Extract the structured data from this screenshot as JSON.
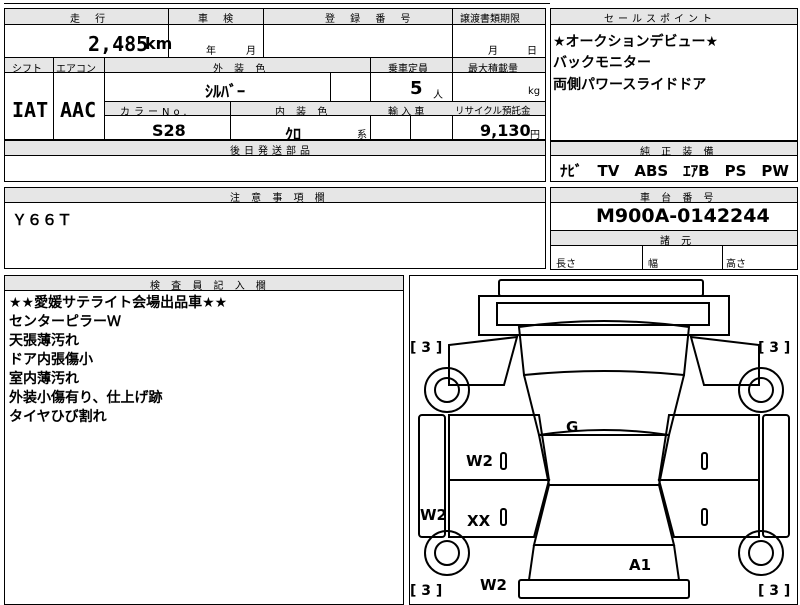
{
  "labels": {
    "mileage": "走 行",
    "inspection": "車 検",
    "registration": "登 録 番 号",
    "transfer_deadline": "譲渡書類期限",
    "sales_point": "セールスポイント",
    "shift": "シフト",
    "aircon": "エアコン",
    "exterior_color": "外 装 色",
    "capacity": "乗車定員",
    "max_load": "最大積載量",
    "color_no": "カラーNo.",
    "interior_color": "内 装 色",
    "import": "輸 入 車",
    "recycle_fee": "リサイクル預託金",
    "later_parts": "後日発送部品",
    "genuine_equipment": "純 正 装 備",
    "caution": "注 意 事 項 欄",
    "chassis_no": "車 台 番 号",
    "dimensions": "諸 元",
    "inspector_notes": "検 査 員 記 入 欄",
    "length": "長さ",
    "width": "幅",
    "height": "高さ"
  },
  "values": {
    "mileage": "2,485",
    "mileage_unit": "km",
    "inspection_year": "年",
    "inspection_month": "月",
    "transfer_month": "月",
    "transfer_day": "日",
    "shift": "IAT",
    "aircon": "AAC",
    "exterior_color": "ｼﾙﾊﾞｰ",
    "capacity": "5",
    "capacity_unit": "人",
    "max_load_unit": "kg",
    "color_no": "S28",
    "interior_color": "ｸﾛ",
    "interior_suffix": "系",
    "recycle_fee": "9,130",
    "recycle_unit": "円",
    "caution": "Ｙ６６Ｔ",
    "chassis_no": "M900A-0142244",
    "equipment": "ﾅﾋﾞ　TV　ABS　ｴｱB　PS　PW"
  },
  "sales_points": [
    "★オークションデビュー★",
    "バックモニター",
    "両側パワースライドドア"
  ],
  "inspector_notes": [
    "★★愛媛サテライト会場出品車★★",
    "センターピラーＷ",
    "天張薄汚れ",
    "ドア内張傷小",
    "室内薄汚れ",
    "外装小傷有り、仕上げ跡",
    "タイヤひび割れ"
  ],
  "damage_marks": {
    "G": "G",
    "W2_upper": "W2",
    "W2_side": "W2",
    "XX": "XX",
    "W2_lower": "W2",
    "A1": "A1"
  },
  "tire_marks": {
    "front_left": "[ 3 ]",
    "front_right": "[ 3 ]",
    "rear_left": "[ 3 ]",
    "rear_right": "[ 3 ]"
  }
}
